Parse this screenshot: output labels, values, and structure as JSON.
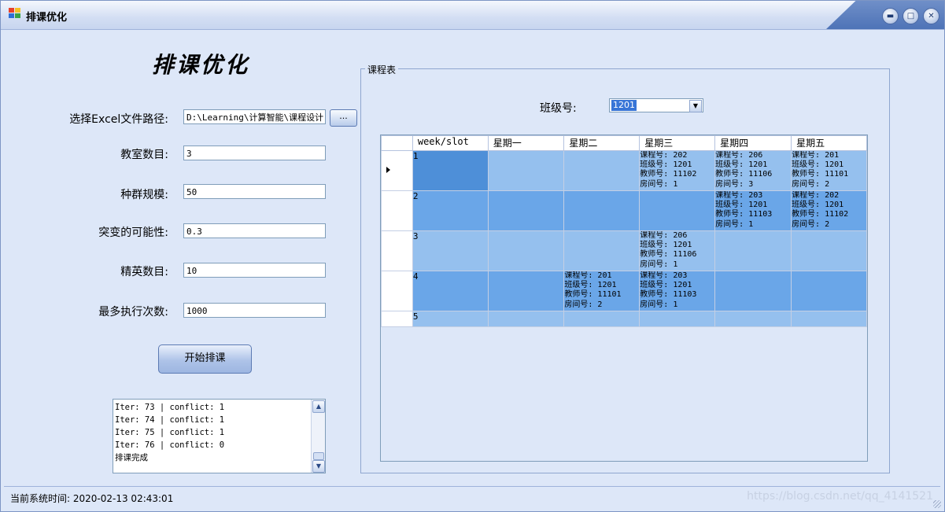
{
  "window": {
    "title": "排课优化"
  },
  "form": {
    "heading": "排课优化",
    "path_label": "选择Excel文件路径:",
    "path_value": "D:\\Learning\\计算智能\\课程设计",
    "browse_label": "...",
    "rooms_label": "教室数目:",
    "rooms_value": "3",
    "population_label": "种群规模:",
    "population_value": "50",
    "mutation_label": "突变的可能性:",
    "mutation_value": "0.3",
    "elite_label": "精英数目:",
    "elite_value": "10",
    "max_iter_label": "最多执行次数:",
    "max_iter_value": "1000",
    "start_label": "开始排课"
  },
  "log": {
    "lines": [
      "Iter: 73 | conflict: 1",
      "Iter: 74 | conflict: 1",
      "Iter: 75 | conflict: 1",
      "Iter: 76 | conflict: 0",
      "排课完成"
    ]
  },
  "schedule": {
    "group_title": "课程表",
    "class_label": "班级号:",
    "class_value": "1201",
    "columns": [
      "week/slot",
      "星期一",
      "星期二",
      "星期三",
      "星期四",
      "星期五"
    ],
    "rows": [
      {
        "slot": "1",
        "cells": [
          "",
          "",
          "课程号: 202\n班级号: 1201\n教师号: 11102\n房间号: 1",
          "课程号: 206\n班级号: 1201\n教师号: 11106\n房间号: 3",
          "课程号: 201\n班级号: 1201\n教师号: 11101\n房间号: 2"
        ]
      },
      {
        "slot": "2",
        "cells": [
          "",
          "",
          "",
          "课程号: 203\n班级号: 1201\n教师号: 11103\n房间号: 1",
          "课程号: 202\n班级号: 1201\n教师号: 11102\n房间号: 2"
        ]
      },
      {
        "slot": "3",
        "cells": [
          "",
          "",
          "课程号: 206\n班级号: 1201\n教师号: 11106\n房间号: 1",
          "",
          ""
        ]
      },
      {
        "slot": "4",
        "cells": [
          "",
          "课程号: 201\n班级号: 1201\n教师号: 11101\n房间号: 2",
          "课程号: 203\n班级号: 1201\n教师号: 11103\n房间号: 1",
          "",
          ""
        ]
      },
      {
        "slot": "5",
        "cells": [
          "",
          "",
          "",
          "",
          ""
        ]
      }
    ]
  },
  "status": {
    "time_label": "当前系统时间:",
    "time_value": "2020-02-13 02:43:01"
  },
  "watermark": "https://blog.csdn.net/qq_4141521"
}
